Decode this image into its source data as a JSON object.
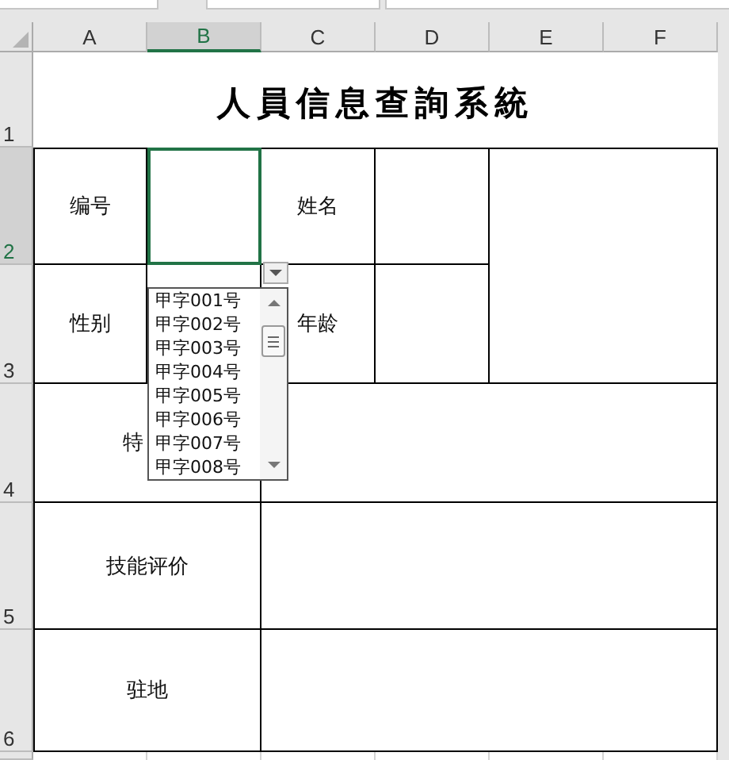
{
  "columns": [
    {
      "label": "A",
      "selected": false
    },
    {
      "label": "B",
      "selected": true
    },
    {
      "label": "C",
      "selected": false
    },
    {
      "label": "D",
      "selected": false
    },
    {
      "label": "E",
      "selected": false
    },
    {
      "label": "F",
      "selected": false
    }
  ],
  "rows": [
    {
      "label": "1",
      "selected": false
    },
    {
      "label": "2",
      "selected": true
    },
    {
      "label": "3",
      "selected": false
    },
    {
      "label": "4",
      "selected": false
    },
    {
      "label": "5",
      "selected": false
    },
    {
      "label": "6",
      "selected": false
    }
  ],
  "form": {
    "title": "人員信息查詢系統",
    "fields": [
      {
        "label": "编号",
        "selected": true
      },
      {
        "label": "姓名",
        "selected": false
      },
      {
        "label": "性别",
        "selected": false
      },
      {
        "label": "年龄",
        "selected": false
      }
    ],
    "sections": [
      "特",
      "技能评价",
      "驻地"
    ]
  },
  "dropdown": {
    "items": [
      "甲字001号",
      "甲字002号",
      "甲字003号",
      "甲字004号",
      "甲字005号",
      "甲字006号",
      "甲字007号",
      "甲字008号"
    ]
  }
}
